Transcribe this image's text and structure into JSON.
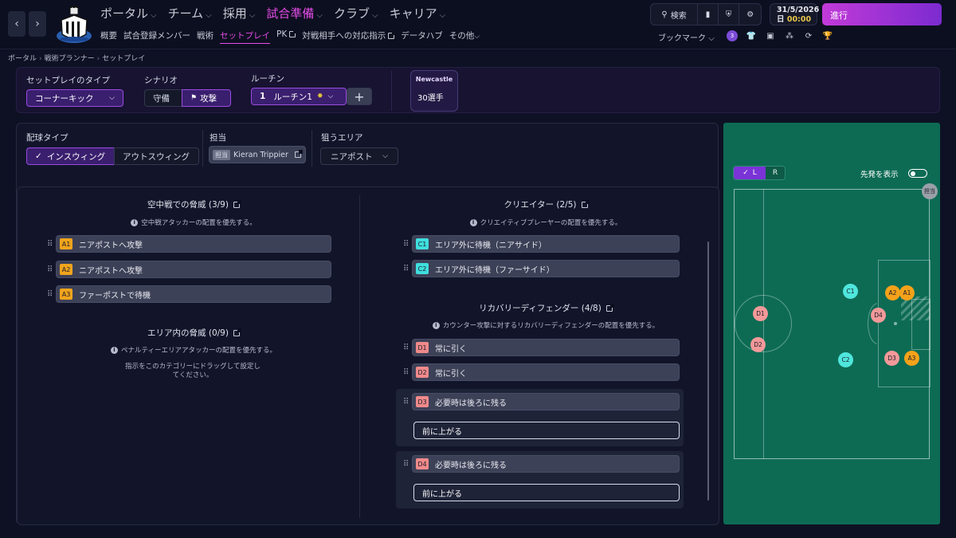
{
  "nav": {
    "back": "‹",
    "forward": "›",
    "main": [
      {
        "label": "ポータル",
        "active": false
      },
      {
        "label": "チーム",
        "active": false
      },
      {
        "label": "採用",
        "active": false
      },
      {
        "label": "試合準備",
        "active": true
      },
      {
        "label": "クラブ",
        "active": false
      },
      {
        "label": "キャリア",
        "active": false
      }
    ],
    "sub": [
      {
        "label": "概要"
      },
      {
        "label": "試合登録メンバー"
      },
      {
        "label": "戦術"
      },
      {
        "label": "セットプレイ",
        "active": true
      },
      {
        "label": "PK",
        "external": true
      },
      {
        "label": "対戦相手への対応指示",
        "external": true
      },
      {
        "label": "データハブ"
      },
      {
        "label": "その他"
      }
    ]
  },
  "toolbar": {
    "search_label": "検索",
    "date": "31/5/2026",
    "day": "日",
    "time": "00:00",
    "proceed_label": "進行",
    "bookmark_label": "ブックマーク",
    "bookmark_badge": "3"
  },
  "breadcrumb": [
    "ポータル",
    "戦術プランナー",
    "セットプレイ"
  ],
  "setpiece": {
    "type_label": "セットプレイのタイプ",
    "type_value": "コーナーキック",
    "scenario_label": "シナリオ",
    "scenario_defend": "守備",
    "scenario_attack": "攻撃",
    "routine_label": "ルーチン",
    "routine_number": "1",
    "routine_name": "ルーチン1",
    "club_name": "Newcastle",
    "players_count": "30選手"
  },
  "delivery": {
    "type_label": "配球タイプ",
    "inswing": "インスウィング",
    "outswing": "アウトスウィング",
    "taker_label": "担当",
    "taker_tag": "担当",
    "taker_name": "Kieran Trippier",
    "area_label": "狙うエリア",
    "area_value": "ニアポスト"
  },
  "left_sections": {
    "aerial_title": "空中戦での脅威 (3/9)",
    "aerial_sub": "空中戦アタッカーの配置を優先する。",
    "aerial_rows": [
      {
        "code": "A1",
        "text": "ニアポストへ攻撃"
      },
      {
        "code": "A2",
        "text": "ニアポストへ攻撃"
      },
      {
        "code": "A3",
        "text": "ファーポストで待機"
      }
    ],
    "box_title": "エリア内の脅威 (0/9)",
    "box_sub": "ペナルティーエリアアタッカーの配置を優先する。",
    "box_empty": "指示をこのカテゴリーにドラッグして設定してください。"
  },
  "right_sections": {
    "creator_title": "クリエイター (2/5)",
    "creator_sub": "クリエイティブプレーヤーの配置を優先する。",
    "creator_rows": [
      {
        "code": "C1",
        "text": "エリア外に待機（ニアサイド）"
      },
      {
        "code": "C2",
        "text": "エリア外に待機（ファーサイド）"
      }
    ],
    "recovery_title": "リカバリーディフェンダー (4/8)",
    "recovery_sub": "カウンター攻撃に対するリカバリーディフェンダーの配置を優先する。",
    "recovery_rows": [
      {
        "code": "D1",
        "text": "常に引く"
      },
      {
        "code": "D2",
        "text": "常に引く"
      },
      {
        "code": "D3",
        "text": "必要時は後ろに残る",
        "option": "前に上がる"
      },
      {
        "code": "D4",
        "text": "必要時は後ろに残る",
        "option": "前に上がる"
      }
    ]
  },
  "pitch": {
    "side_l": "L",
    "side_r": "R",
    "show_starters_label": "先発を表示",
    "taker_marker": "担当",
    "players": [
      {
        "code": "A1"
      },
      {
        "code": "A2"
      },
      {
        "code": "A3"
      },
      {
        "code": "C1"
      },
      {
        "code": "C2"
      },
      {
        "code": "D1"
      },
      {
        "code": "D2"
      },
      {
        "code": "D3"
      },
      {
        "code": "D4"
      }
    ]
  }
}
